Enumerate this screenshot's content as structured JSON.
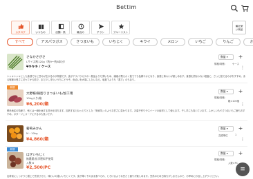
{
  "header": {
    "title": "Bettim"
  },
  "tabs": [
    {
      "label": "カタログ",
      "icon": "thumbs-up-icon",
      "active": true
    },
    {
      "label": "いつもの",
      "icon": "book-icon",
      "active": false
    },
    {
      "label": "店舗・魚",
      "icon": "receipt-icon",
      "active": false
    },
    {
      "label": "最近の",
      "icon": "history-icon",
      "active": false
    },
    {
      "label": "チラシ",
      "icon": "send-icon",
      "active": false
    },
    {
      "label": "ブルーリスト",
      "icon": "star-icon",
      "active": false
    }
  ],
  "favorite_button": {
    "line1": "最近使",
    "line2": "い商品"
  },
  "categories": [
    {
      "label": "すべて",
      "active": true
    },
    {
      "label": "アスパラガス"
    },
    {
      "label": "さつまいも"
    },
    {
      "label": "いちじく"
    },
    {
      "label": "キウイ"
    },
    {
      "label": "メロン"
    },
    {
      "label": "いちご"
    },
    {
      "label": "りんご"
    },
    {
      "label": "かんきつ"
    }
  ],
  "items": [
    {
      "badge": "",
      "name": "さなかさがさ",
      "spec": "Lサイズ約120g（約9〜約8本分）",
      "price": "¥キキキ / ケース",
      "qty_label": "数量",
      "side_line1": "規格/特徴：",
      "side_line2": "ケース",
      "description": "シャキシャキとした食感でなと甘みが広がるのが特徴です。皮がアスパラガスの一般品よりも薄いため、繊維が柔らかく茹でても色鮮やかになり、食感と味わいが楽しめます。食感を損なわない程度に、さっと茹でるのがおすすめ。ある程度の長さに切ってから茹で、まだ少し冷たいうちにどうぞ。色合いを大事にしたいなら、塩茹でよりも「蒸す」のもあり。"
    },
    {
      "badge": "新規",
      "name": "大野様/鍋島りさつまいも/加工用",
      "spec": "10kg入り/箱",
      "price": "¥6,200/箱",
      "qty_label": "数量",
      "side_line1": "規格/特徴：",
      "side_line2": "箱×100個",
      "description": "鍋島地区の特産で、他とは一線を画する甘みを持ちます。加熱するとねっとりとした「安納芋」のような甘さに変わります。お菓子作りやスイーツの素材として使えます。干し芋にも向いています。ふかしいもやさつまいもご飯もおすすめ。ポタージュスープにするのも良いです。"
    },
    {
      "badge": "",
      "name": "葡萄みかん",
      "spec": "M・10kg",
      "price": "¥4,860/箱",
      "qty_label": "数量",
      "side_line1": "交換単位",
      "side_line2": "1",
      "description": ""
    },
    {
      "badge": "新規",
      "name": "ほぜいちじく",
      "spec": "無農薬/化学肥料不使用",
      "spec2": "入数:6",
      "price": "¥2,500/PC",
      "qty_label": "数量",
      "side_line1": "規格/特徴：",
      "side_line2": "入数×PC",
      "description": "出荷前にしっかりと樹上で完熟させた、味わいの濃いいちじくです。皮が薄くそのまま食べられ、とろけるような甘さと香りが楽しめます。完熟のため日持ちがしませんので、お早めにお召し上がりください。"
    }
  ],
  "fab": {
    "label": "≡"
  },
  "colors": {
    "accent": "#e5552a",
    "badge_orange": "#f08a2c",
    "badge_blue": "#3b8bd6"
  }
}
